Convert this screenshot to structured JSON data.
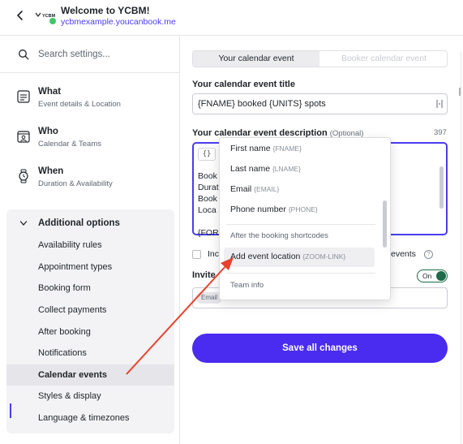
{
  "header": {
    "title": "Welcome to YCBM!",
    "subtitle": "ycbmexample.youcanbook.me",
    "logo_text": "YCBM",
    "accent": "#4a3cf0"
  },
  "sidebar": {
    "search_placeholder": "Search settings...",
    "sections": [
      {
        "title": "What",
        "sub": "Event details & Location",
        "icon": "document-icon"
      },
      {
        "title": "Who",
        "sub": "Calendar & Teams",
        "icon": "person-calendar-icon"
      },
      {
        "title": "When",
        "sub": "Duration & Availability",
        "icon": "watch-icon"
      }
    ],
    "additional": {
      "title": "Additional options",
      "items": [
        "Availability rules",
        "Appointment types",
        "Booking form",
        "Collect payments",
        "After booking",
        "Notifications",
        "Calendar events",
        "Styles & display",
        "Language & timezones"
      ],
      "active": "Calendar events"
    }
  },
  "main": {
    "tabs": [
      "Your calendar event",
      "Booker calendar event"
    ],
    "title_label": "Your calendar event title",
    "title_value": "{FNAME} booked {UNITS} spots",
    "desc_label": "Your calendar event description",
    "desc_optional": "(Optional)",
    "desc_counter": "397",
    "desc_brace": "{}",
    "desc_lines": [
      "Book",
      "Durat",
      "Book",
      "Loca",
      "{FOR"
    ],
    "checkbox_left": "Inc",
    "checkbox_right": "events",
    "invite_label": "Invite",
    "toggle_label": "On",
    "guest_chip": "Email",
    "save_label": "Save all changes"
  },
  "dropdown": {
    "items_top": [
      {
        "label": "First name",
        "code": "{FNAME}"
      },
      {
        "label": "Last name",
        "code": "{LNAME}"
      },
      {
        "label": "Email",
        "code": "{EMAIL}"
      },
      {
        "label": "Phone number",
        "code": "{PHONE}"
      }
    ],
    "section_after": "After the booking shortcodes",
    "highlighted": {
      "label": "Add event location",
      "code": "{ZOOM-LINK}"
    },
    "section_team": "Team info"
  },
  "colors": {
    "primary_button": "#4a2bf0",
    "toggle_on": "#1d6b4a",
    "annotation_arrow": "#e8412c"
  }
}
